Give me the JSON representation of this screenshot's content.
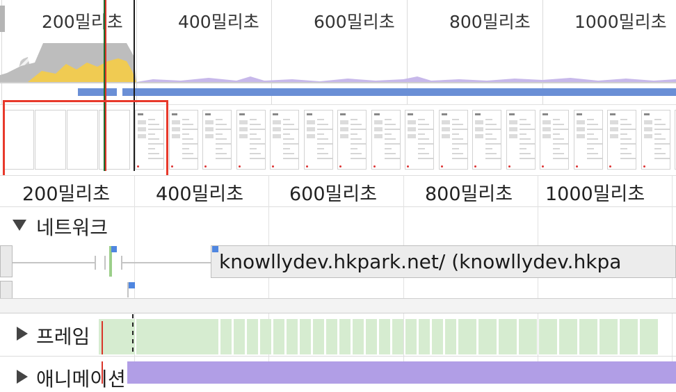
{
  "overview": {
    "tick_labels": [
      "200밀리초",
      "400밀리초",
      "600밀리초",
      "800밀리초",
      "1000밀리초"
    ]
  },
  "ruler": {
    "tick_labels": [
      "200밀리초",
      "400밀리초",
      "600밀리초",
      "800밀리초",
      "1000밀리초"
    ]
  },
  "tracks": {
    "network_title": "네트워크",
    "network_request_label": "knowllydev.hkpark.net/ (knowllydev.hkpa",
    "frames_title": "프레임",
    "animations_title": "애니메이션"
  },
  "colors": {
    "scripting": "#f2cf4f",
    "rendering": "#a98fd9",
    "cpu_gray": "#b9b9b9",
    "network_bar": "#6a8fd6",
    "selection": "#e8392b",
    "frame_green": "#d6ecd0",
    "animation_purple": "#b19ee6",
    "request_blue": "#4f86e0"
  },
  "icons": {
    "network_toggle": "triangle-down-icon",
    "frames_toggle": "triangle-right-icon",
    "animations_toggle": "triangle-right-icon"
  }
}
